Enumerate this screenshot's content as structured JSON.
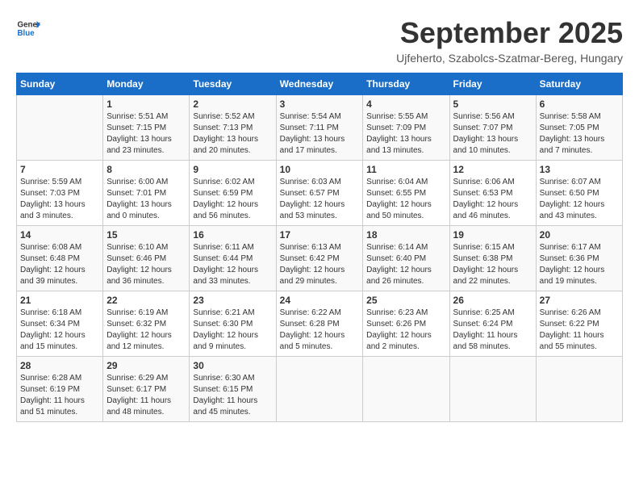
{
  "header": {
    "logo_general": "General",
    "logo_blue": "Blue",
    "month": "September 2025",
    "location": "Ujfeherto, Szabolcs-Szatmar-Bereg, Hungary"
  },
  "columns": [
    "Sunday",
    "Monday",
    "Tuesday",
    "Wednesday",
    "Thursday",
    "Friday",
    "Saturday"
  ],
  "weeks": [
    [
      {
        "day": "",
        "info": ""
      },
      {
        "day": "1",
        "info": "Sunrise: 5:51 AM\nSunset: 7:15 PM\nDaylight: 13 hours\nand 23 minutes."
      },
      {
        "day": "2",
        "info": "Sunrise: 5:52 AM\nSunset: 7:13 PM\nDaylight: 13 hours\nand 20 minutes."
      },
      {
        "day": "3",
        "info": "Sunrise: 5:54 AM\nSunset: 7:11 PM\nDaylight: 13 hours\nand 17 minutes."
      },
      {
        "day": "4",
        "info": "Sunrise: 5:55 AM\nSunset: 7:09 PM\nDaylight: 13 hours\nand 13 minutes."
      },
      {
        "day": "5",
        "info": "Sunrise: 5:56 AM\nSunset: 7:07 PM\nDaylight: 13 hours\nand 10 minutes."
      },
      {
        "day": "6",
        "info": "Sunrise: 5:58 AM\nSunset: 7:05 PM\nDaylight: 13 hours\nand 7 minutes."
      }
    ],
    [
      {
        "day": "7",
        "info": "Sunrise: 5:59 AM\nSunset: 7:03 PM\nDaylight: 13 hours\nand 3 minutes."
      },
      {
        "day": "8",
        "info": "Sunrise: 6:00 AM\nSunset: 7:01 PM\nDaylight: 13 hours\nand 0 minutes."
      },
      {
        "day": "9",
        "info": "Sunrise: 6:02 AM\nSunset: 6:59 PM\nDaylight: 12 hours\nand 56 minutes."
      },
      {
        "day": "10",
        "info": "Sunrise: 6:03 AM\nSunset: 6:57 PM\nDaylight: 12 hours\nand 53 minutes."
      },
      {
        "day": "11",
        "info": "Sunrise: 6:04 AM\nSunset: 6:55 PM\nDaylight: 12 hours\nand 50 minutes."
      },
      {
        "day": "12",
        "info": "Sunrise: 6:06 AM\nSunset: 6:53 PM\nDaylight: 12 hours\nand 46 minutes."
      },
      {
        "day": "13",
        "info": "Sunrise: 6:07 AM\nSunset: 6:50 PM\nDaylight: 12 hours\nand 43 minutes."
      }
    ],
    [
      {
        "day": "14",
        "info": "Sunrise: 6:08 AM\nSunset: 6:48 PM\nDaylight: 12 hours\nand 39 minutes."
      },
      {
        "day": "15",
        "info": "Sunrise: 6:10 AM\nSunset: 6:46 PM\nDaylight: 12 hours\nand 36 minutes."
      },
      {
        "day": "16",
        "info": "Sunrise: 6:11 AM\nSunset: 6:44 PM\nDaylight: 12 hours\nand 33 minutes."
      },
      {
        "day": "17",
        "info": "Sunrise: 6:13 AM\nSunset: 6:42 PM\nDaylight: 12 hours\nand 29 minutes."
      },
      {
        "day": "18",
        "info": "Sunrise: 6:14 AM\nSunset: 6:40 PM\nDaylight: 12 hours\nand 26 minutes."
      },
      {
        "day": "19",
        "info": "Sunrise: 6:15 AM\nSunset: 6:38 PM\nDaylight: 12 hours\nand 22 minutes."
      },
      {
        "day": "20",
        "info": "Sunrise: 6:17 AM\nSunset: 6:36 PM\nDaylight: 12 hours\nand 19 minutes."
      }
    ],
    [
      {
        "day": "21",
        "info": "Sunrise: 6:18 AM\nSunset: 6:34 PM\nDaylight: 12 hours\nand 15 minutes."
      },
      {
        "day": "22",
        "info": "Sunrise: 6:19 AM\nSunset: 6:32 PM\nDaylight: 12 hours\nand 12 minutes."
      },
      {
        "day": "23",
        "info": "Sunrise: 6:21 AM\nSunset: 6:30 PM\nDaylight: 12 hours\nand 9 minutes."
      },
      {
        "day": "24",
        "info": "Sunrise: 6:22 AM\nSunset: 6:28 PM\nDaylight: 12 hours\nand 5 minutes."
      },
      {
        "day": "25",
        "info": "Sunrise: 6:23 AM\nSunset: 6:26 PM\nDaylight: 12 hours\nand 2 minutes."
      },
      {
        "day": "26",
        "info": "Sunrise: 6:25 AM\nSunset: 6:24 PM\nDaylight: 11 hours\nand 58 minutes."
      },
      {
        "day": "27",
        "info": "Sunrise: 6:26 AM\nSunset: 6:22 PM\nDaylight: 11 hours\nand 55 minutes."
      }
    ],
    [
      {
        "day": "28",
        "info": "Sunrise: 6:28 AM\nSunset: 6:19 PM\nDaylight: 11 hours\nand 51 minutes."
      },
      {
        "day": "29",
        "info": "Sunrise: 6:29 AM\nSunset: 6:17 PM\nDaylight: 11 hours\nand 48 minutes."
      },
      {
        "day": "30",
        "info": "Sunrise: 6:30 AM\nSunset: 6:15 PM\nDaylight: 11 hours\nand 45 minutes."
      },
      {
        "day": "",
        "info": ""
      },
      {
        "day": "",
        "info": ""
      },
      {
        "day": "",
        "info": ""
      },
      {
        "day": "",
        "info": ""
      }
    ]
  ]
}
